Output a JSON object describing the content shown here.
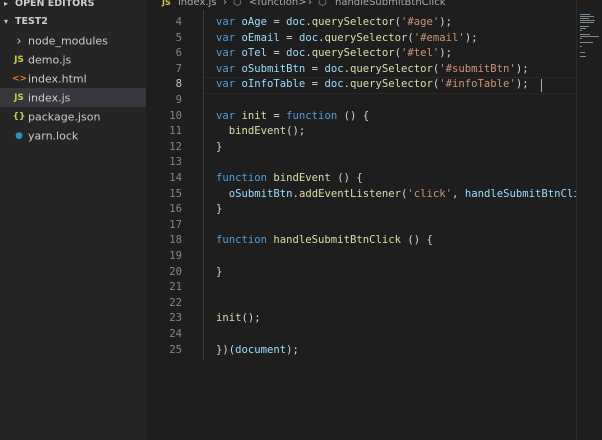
{
  "sidebar": {
    "open_editors_label": "OPEN EDITORS",
    "project_label": "TEST2",
    "items": [
      {
        "label": "node_modules",
        "icon": "chevron-right-icon",
        "glyph": "›",
        "color": "#c5c5c5",
        "active": false
      },
      {
        "label": "demo.js",
        "icon": "javascript-file-icon",
        "glyph": "JS",
        "color": "#cbcb41",
        "active": false
      },
      {
        "label": "index.html",
        "icon": "html-file-icon",
        "glyph": "<>",
        "color": "#e37933",
        "active": false
      },
      {
        "label": "index.js",
        "icon": "javascript-file-icon",
        "glyph": "JS",
        "color": "#cbcb41",
        "active": true
      },
      {
        "label": "package.json",
        "icon": "json-file-icon",
        "glyph": "{}",
        "color": "#cbcb41",
        "active": false
      },
      {
        "label": "yarn.lock",
        "icon": "yarn-file-icon",
        "glyph": "●",
        "color": "#2c8ebb",
        "active": false
      }
    ]
  },
  "breadcrumb": {
    "file": "index.js",
    "scope1": "<function>",
    "scope2": "handleSubmitBtnClick"
  },
  "editor": {
    "current_line": 8,
    "lines": [
      {
        "n": 4,
        "tokens": [
          [
            "kw",
            "var "
          ],
          [
            "vr",
            "oAge"
          ],
          [
            "pn",
            " = "
          ],
          [
            "vr",
            "doc"
          ],
          [
            "pn",
            "."
          ],
          [
            "fn",
            "querySelector"
          ],
          [
            "pn",
            "("
          ],
          [
            "st",
            "'#age'"
          ],
          [
            "pn",
            ");"
          ]
        ]
      },
      {
        "n": 5,
        "tokens": [
          [
            "kw",
            "var "
          ],
          [
            "vr",
            "oEmail"
          ],
          [
            "pn",
            " = "
          ],
          [
            "vr",
            "doc"
          ],
          [
            "pn",
            "."
          ],
          [
            "fn",
            "querySelector"
          ],
          [
            "pn",
            "("
          ],
          [
            "st",
            "'#email'"
          ],
          [
            "pn",
            ");"
          ]
        ]
      },
      {
        "n": 6,
        "tokens": [
          [
            "kw",
            "var "
          ],
          [
            "vr",
            "oTel"
          ],
          [
            "pn",
            " = "
          ],
          [
            "vr",
            "doc"
          ],
          [
            "pn",
            "."
          ],
          [
            "fn",
            "querySelector"
          ],
          [
            "pn",
            "("
          ],
          [
            "st",
            "'#tel'"
          ],
          [
            "pn",
            ");"
          ]
        ]
      },
      {
        "n": 7,
        "tokens": [
          [
            "kw",
            "var "
          ],
          [
            "vr",
            "oSubmitBtn"
          ],
          [
            "pn",
            " = "
          ],
          [
            "vr",
            "doc"
          ],
          [
            "pn",
            "."
          ],
          [
            "fn",
            "querySelector"
          ],
          [
            "pn",
            "("
          ],
          [
            "st",
            "'#submitBtn'"
          ],
          [
            "pn",
            ");"
          ]
        ]
      },
      {
        "n": 8,
        "tokens": [
          [
            "kw",
            "var "
          ],
          [
            "vr",
            "oInfoTable"
          ],
          [
            "pn",
            " = "
          ],
          [
            "vr",
            "doc"
          ],
          [
            "pn",
            "."
          ],
          [
            "fn",
            "querySelector"
          ],
          [
            "pn",
            "("
          ],
          [
            "st",
            "'#infoTable'"
          ],
          [
            "pn",
            ");"
          ]
        ]
      },
      {
        "n": 9,
        "tokens": []
      },
      {
        "n": 10,
        "tokens": [
          [
            "kw",
            "var "
          ],
          [
            "fn",
            "init"
          ],
          [
            "pn",
            " = "
          ],
          [
            "kw",
            "function"
          ],
          [
            "pn",
            " () {"
          ]
        ]
      },
      {
        "n": 11,
        "tokens": [
          [
            "pn",
            "  "
          ],
          [
            "fn",
            "bindEvent"
          ],
          [
            "pn",
            "();"
          ]
        ]
      },
      {
        "n": 12,
        "tokens": [
          [
            "pn",
            "}"
          ]
        ]
      },
      {
        "n": 13,
        "tokens": []
      },
      {
        "n": 14,
        "tokens": [
          [
            "kw",
            "function "
          ],
          [
            "fn",
            "bindEvent"
          ],
          [
            "pn",
            " () {"
          ]
        ]
      },
      {
        "n": 15,
        "tokens": [
          [
            "pn",
            "  "
          ],
          [
            "vr",
            "oSubmitBtn"
          ],
          [
            "pn",
            "."
          ],
          [
            "fn",
            "addEventListener"
          ],
          [
            "pn",
            "("
          ],
          [
            "st",
            "'click'"
          ],
          [
            "pn",
            ", "
          ],
          [
            "vr",
            "handleSubmitBtnClic"
          ]
        ]
      },
      {
        "n": 16,
        "tokens": [
          [
            "pn",
            "}"
          ]
        ]
      },
      {
        "n": 17,
        "tokens": []
      },
      {
        "n": 18,
        "tokens": [
          [
            "kw",
            "function "
          ],
          [
            "fn",
            "handleSubmitBtnClick"
          ],
          [
            "pn",
            " () {"
          ]
        ]
      },
      {
        "n": 19,
        "tokens": []
      },
      {
        "n": 20,
        "tokens": [
          [
            "pn",
            "}"
          ]
        ]
      },
      {
        "n": 21,
        "tokens": []
      },
      {
        "n": 22,
        "tokens": []
      },
      {
        "n": 23,
        "tokens": [
          [
            "fn",
            "init"
          ],
          [
            "pn",
            "();"
          ]
        ]
      },
      {
        "n": 24,
        "tokens": []
      },
      {
        "n": 25,
        "tokens": [
          [
            "pn",
            "})("
          ],
          [
            "vr",
            "document"
          ],
          [
            "pn",
            ");"
          ]
        ]
      }
    ]
  },
  "colors": {
    "keyword": "#569cd6",
    "variable": "#9cdcfe",
    "function": "#dcdcaa",
    "string": "#ce9178",
    "punctuation": "#d4d4d4"
  }
}
